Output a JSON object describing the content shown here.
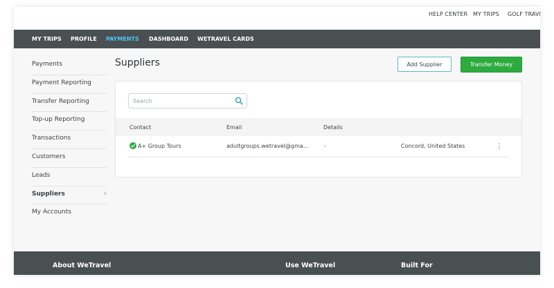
{
  "util_nav": {
    "help_center": "HELP CENTER",
    "my_trips": "MY TRIPS",
    "golf_travel": "GOLF TRAVE"
  },
  "main_nav": {
    "my_trips": "MY TRIPS",
    "profile": "PROFILE",
    "payments": "PAYMENTS",
    "dashboard": "DASHBOARD",
    "wetravel_cards": "WETRAVEL CARDS"
  },
  "sidebar": {
    "items": [
      {
        "label": "Payments"
      },
      {
        "label": "Payment Reporting"
      },
      {
        "label": "Transfer Reporting"
      },
      {
        "label": "Top-up Reporting"
      },
      {
        "label": "Transactions"
      },
      {
        "label": "Customers"
      },
      {
        "label": "Leads"
      },
      {
        "label": "Suppliers",
        "active": true
      },
      {
        "label": "My Accounts"
      }
    ],
    "chevron": "›"
  },
  "page": {
    "title": "Suppliers",
    "add_supplier": "Add Supplier",
    "transfer_money": "Transfer Money"
  },
  "search": {
    "placeholder": "Search"
  },
  "table": {
    "headers": {
      "contact": "Contact",
      "email": "Email",
      "details": "Details"
    },
    "rows": [
      {
        "contact": "A+ Group Tours",
        "email": "adultgroups.wetravel@gma...",
        "details": "-",
        "location": "Concord,  United States"
      }
    ]
  },
  "footer": {
    "about": "About WeTravel",
    "use": "Use WeTravel",
    "built_for": "Built For"
  },
  "colors": {
    "nav_bg": "#4a4f52",
    "accent_blue": "#4fc3f7",
    "primary_green": "#2eab3f",
    "outline_teal": "#5bb8c8"
  },
  "icons": [
    "search-icon",
    "check-circle-icon",
    "chevron-right-icon",
    "kebab-menu-icon"
  ]
}
